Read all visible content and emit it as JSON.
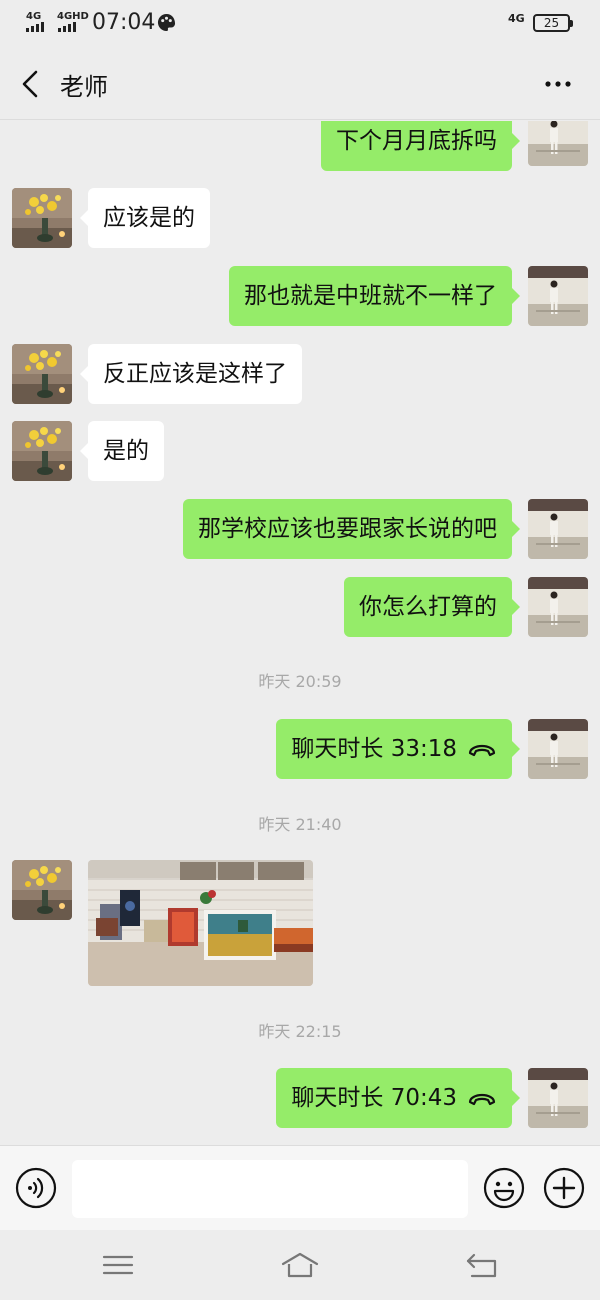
{
  "status_bar": {
    "signal1": "4G",
    "signal2": "4GHD",
    "time": "07:04",
    "signal3": "4G",
    "battery": "25"
  },
  "header": {
    "title": "老师",
    "back_icon": "chevron-left-icon",
    "more_icon": "ellipsis-icon"
  },
  "chat": {
    "messages": [
      {
        "type": "text",
        "from": "me",
        "text": "下个月月底拆吗"
      },
      {
        "type": "text",
        "from": "them",
        "text": "应该是的"
      },
      {
        "type": "text",
        "from": "me",
        "text": "那也就是中班就不一样了"
      },
      {
        "type": "text",
        "from": "them",
        "text": "反正应该是这样了"
      },
      {
        "type": "text",
        "from": "them",
        "text": "是的"
      },
      {
        "type": "text",
        "from": "me",
        "text": "那学校应该也要跟家长说的吧"
      },
      {
        "type": "text",
        "from": "me",
        "text": "你怎么打算的"
      },
      {
        "type": "time",
        "text": "昨天 20:59"
      },
      {
        "type": "call",
        "from": "me",
        "text": "聊天时长 33:18"
      },
      {
        "type": "time",
        "text": "昨天 21:40"
      },
      {
        "type": "image",
        "from": "them"
      },
      {
        "type": "time",
        "text": "昨天 22:15"
      },
      {
        "type": "call",
        "from": "me",
        "text": "聊天时长 70:43"
      }
    ]
  },
  "input_bar": {
    "placeholder": "",
    "voice_icon": "voice-icon",
    "emoji_icon": "emoji-icon",
    "plus_icon": "plus-icon"
  },
  "nav_bar": {
    "menu_icon": "menu-icon",
    "home_icon": "home-icon",
    "back_icon": "back-icon"
  },
  "colors": {
    "background": "#ededed",
    "my_bubble": "#95ec69",
    "their_bubble": "#ffffff",
    "timestamp": "#a8a8a8"
  }
}
